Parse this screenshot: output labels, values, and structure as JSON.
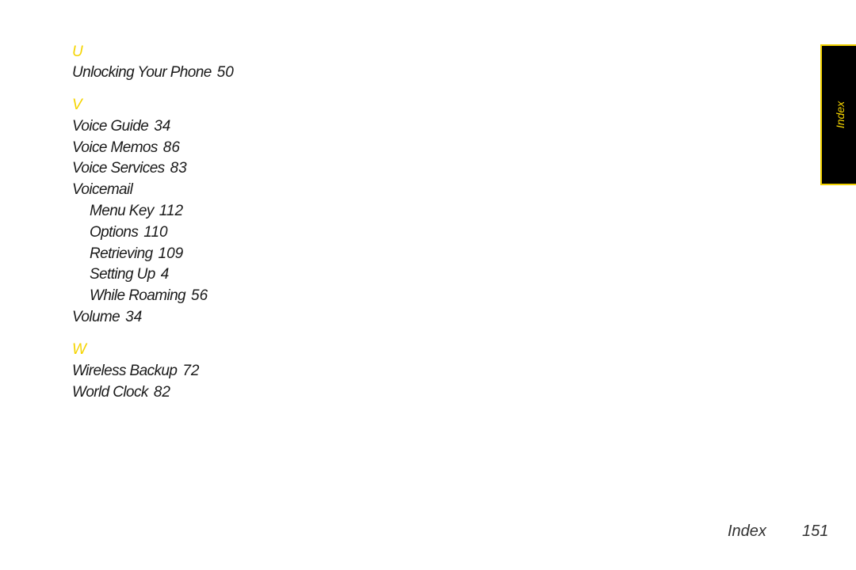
{
  "sections": [
    {
      "letter": "U",
      "entries": [
        {
          "text": "Unlocking Your Phone",
          "page": "50",
          "level": 0
        }
      ]
    },
    {
      "letter": "V",
      "entries": [
        {
          "text": "Voice Guide",
          "page": "34",
          "level": 0
        },
        {
          "text": "Voice Memos",
          "page": "86",
          "level": 0
        },
        {
          "text": "Voice Services",
          "page": "83",
          "level": 0
        },
        {
          "text": "Voicemail",
          "page": "",
          "level": 0
        },
        {
          "text": "Menu Key",
          "page": "112",
          "level": 1
        },
        {
          "text": "Options",
          "page": "110",
          "level": 1
        },
        {
          "text": "Retrieving",
          "page": "109",
          "level": 1
        },
        {
          "text": "Setting Up",
          "page": "4",
          "level": 1
        },
        {
          "text": "While Roaming",
          "page": "56",
          "level": 1
        },
        {
          "text": "Volume",
          "page": "34",
          "level": 0
        }
      ]
    },
    {
      "letter": "W",
      "entries": [
        {
          "text": "Wireless Backup",
          "page": "72",
          "level": 0
        },
        {
          "text": "World Clock",
          "page": "82",
          "level": 0
        }
      ]
    }
  ],
  "side_tab": {
    "label": "Index"
  },
  "footer": {
    "title": "Index",
    "page_number": "151"
  },
  "colors": {
    "accent": "#f5d400",
    "tab_background": "#000000",
    "text": "#1a1a1a"
  }
}
